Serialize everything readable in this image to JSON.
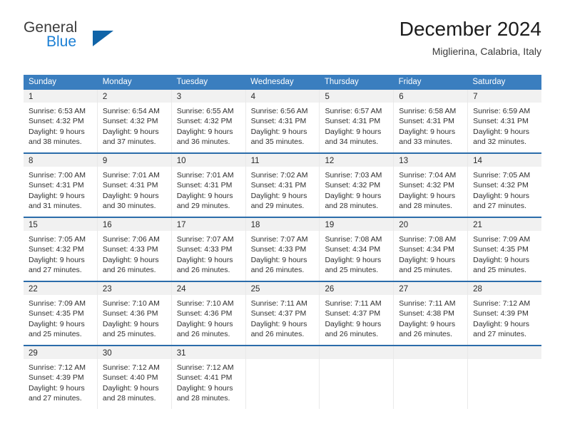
{
  "brand": {
    "name_part1": "General",
    "name_part2": "Blue",
    "logo_icon": "triangle-logo-icon"
  },
  "header": {
    "title": "December 2024",
    "subtitle": "Miglierina, Calabria, Italy"
  },
  "colors": {
    "header_blue": "#3a7ebf",
    "row_separator_blue": "#2b6caa",
    "daynum_band": "#f1f1f1",
    "brand_blue": "#1b7fd4",
    "logo_blue": "#1064a8"
  },
  "calendar": {
    "weekday_headers": [
      "Sunday",
      "Monday",
      "Tuesday",
      "Wednesday",
      "Thursday",
      "Friday",
      "Saturday"
    ],
    "weeks": [
      [
        {
          "day": "1",
          "sunrise": "Sunrise: 6:53 AM",
          "sunset": "Sunset: 4:32 PM",
          "daylight_line1": "Daylight: 9 hours",
          "daylight_line2": "and 38 minutes."
        },
        {
          "day": "2",
          "sunrise": "Sunrise: 6:54 AM",
          "sunset": "Sunset: 4:32 PM",
          "daylight_line1": "Daylight: 9 hours",
          "daylight_line2": "and 37 minutes."
        },
        {
          "day": "3",
          "sunrise": "Sunrise: 6:55 AM",
          "sunset": "Sunset: 4:32 PM",
          "daylight_line1": "Daylight: 9 hours",
          "daylight_line2": "and 36 minutes."
        },
        {
          "day": "4",
          "sunrise": "Sunrise: 6:56 AM",
          "sunset": "Sunset: 4:31 PM",
          "daylight_line1": "Daylight: 9 hours",
          "daylight_line2": "and 35 minutes."
        },
        {
          "day": "5",
          "sunrise": "Sunrise: 6:57 AM",
          "sunset": "Sunset: 4:31 PM",
          "daylight_line1": "Daylight: 9 hours",
          "daylight_line2": "and 34 minutes."
        },
        {
          "day": "6",
          "sunrise": "Sunrise: 6:58 AM",
          "sunset": "Sunset: 4:31 PM",
          "daylight_line1": "Daylight: 9 hours",
          "daylight_line2": "and 33 minutes."
        },
        {
          "day": "7",
          "sunrise": "Sunrise: 6:59 AM",
          "sunset": "Sunset: 4:31 PM",
          "daylight_line1": "Daylight: 9 hours",
          "daylight_line2": "and 32 minutes."
        }
      ],
      [
        {
          "day": "8",
          "sunrise": "Sunrise: 7:00 AM",
          "sunset": "Sunset: 4:31 PM",
          "daylight_line1": "Daylight: 9 hours",
          "daylight_line2": "and 31 minutes."
        },
        {
          "day": "9",
          "sunrise": "Sunrise: 7:01 AM",
          "sunset": "Sunset: 4:31 PM",
          "daylight_line1": "Daylight: 9 hours",
          "daylight_line2": "and 30 minutes."
        },
        {
          "day": "10",
          "sunrise": "Sunrise: 7:01 AM",
          "sunset": "Sunset: 4:31 PM",
          "daylight_line1": "Daylight: 9 hours",
          "daylight_line2": "and 29 minutes."
        },
        {
          "day": "11",
          "sunrise": "Sunrise: 7:02 AM",
          "sunset": "Sunset: 4:31 PM",
          "daylight_line1": "Daylight: 9 hours",
          "daylight_line2": "and 29 minutes."
        },
        {
          "day": "12",
          "sunrise": "Sunrise: 7:03 AM",
          "sunset": "Sunset: 4:32 PM",
          "daylight_line1": "Daylight: 9 hours",
          "daylight_line2": "and 28 minutes."
        },
        {
          "day": "13",
          "sunrise": "Sunrise: 7:04 AM",
          "sunset": "Sunset: 4:32 PM",
          "daylight_line1": "Daylight: 9 hours",
          "daylight_line2": "and 28 minutes."
        },
        {
          "day": "14",
          "sunrise": "Sunrise: 7:05 AM",
          "sunset": "Sunset: 4:32 PM",
          "daylight_line1": "Daylight: 9 hours",
          "daylight_line2": "and 27 minutes."
        }
      ],
      [
        {
          "day": "15",
          "sunrise": "Sunrise: 7:05 AM",
          "sunset": "Sunset: 4:32 PM",
          "daylight_line1": "Daylight: 9 hours",
          "daylight_line2": "and 27 minutes."
        },
        {
          "day": "16",
          "sunrise": "Sunrise: 7:06 AM",
          "sunset": "Sunset: 4:33 PM",
          "daylight_line1": "Daylight: 9 hours",
          "daylight_line2": "and 26 minutes."
        },
        {
          "day": "17",
          "sunrise": "Sunrise: 7:07 AM",
          "sunset": "Sunset: 4:33 PM",
          "daylight_line1": "Daylight: 9 hours",
          "daylight_line2": "and 26 minutes."
        },
        {
          "day": "18",
          "sunrise": "Sunrise: 7:07 AM",
          "sunset": "Sunset: 4:33 PM",
          "daylight_line1": "Daylight: 9 hours",
          "daylight_line2": "and 26 minutes."
        },
        {
          "day": "19",
          "sunrise": "Sunrise: 7:08 AM",
          "sunset": "Sunset: 4:34 PM",
          "daylight_line1": "Daylight: 9 hours",
          "daylight_line2": "and 25 minutes."
        },
        {
          "day": "20",
          "sunrise": "Sunrise: 7:08 AM",
          "sunset": "Sunset: 4:34 PM",
          "daylight_line1": "Daylight: 9 hours",
          "daylight_line2": "and 25 minutes."
        },
        {
          "day": "21",
          "sunrise": "Sunrise: 7:09 AM",
          "sunset": "Sunset: 4:35 PM",
          "daylight_line1": "Daylight: 9 hours",
          "daylight_line2": "and 25 minutes."
        }
      ],
      [
        {
          "day": "22",
          "sunrise": "Sunrise: 7:09 AM",
          "sunset": "Sunset: 4:35 PM",
          "daylight_line1": "Daylight: 9 hours",
          "daylight_line2": "and 25 minutes."
        },
        {
          "day": "23",
          "sunrise": "Sunrise: 7:10 AM",
          "sunset": "Sunset: 4:36 PM",
          "daylight_line1": "Daylight: 9 hours",
          "daylight_line2": "and 25 minutes."
        },
        {
          "day": "24",
          "sunrise": "Sunrise: 7:10 AM",
          "sunset": "Sunset: 4:36 PM",
          "daylight_line1": "Daylight: 9 hours",
          "daylight_line2": "and 26 minutes."
        },
        {
          "day": "25",
          "sunrise": "Sunrise: 7:11 AM",
          "sunset": "Sunset: 4:37 PM",
          "daylight_line1": "Daylight: 9 hours",
          "daylight_line2": "and 26 minutes."
        },
        {
          "day": "26",
          "sunrise": "Sunrise: 7:11 AM",
          "sunset": "Sunset: 4:37 PM",
          "daylight_line1": "Daylight: 9 hours",
          "daylight_line2": "and 26 minutes."
        },
        {
          "day": "27",
          "sunrise": "Sunrise: 7:11 AM",
          "sunset": "Sunset: 4:38 PM",
          "daylight_line1": "Daylight: 9 hours",
          "daylight_line2": "and 26 minutes."
        },
        {
          "day": "28",
          "sunrise": "Sunrise: 7:12 AM",
          "sunset": "Sunset: 4:39 PM",
          "daylight_line1": "Daylight: 9 hours",
          "daylight_line2": "and 27 minutes."
        }
      ],
      [
        {
          "day": "29",
          "sunrise": "Sunrise: 7:12 AM",
          "sunset": "Sunset: 4:39 PM",
          "daylight_line1": "Daylight: 9 hours",
          "daylight_line2": "and 27 minutes."
        },
        {
          "day": "30",
          "sunrise": "Sunrise: 7:12 AM",
          "sunset": "Sunset: 4:40 PM",
          "daylight_line1": "Daylight: 9 hours",
          "daylight_line2": "and 28 minutes."
        },
        {
          "day": "31",
          "sunrise": "Sunrise: 7:12 AM",
          "sunset": "Sunset: 4:41 PM",
          "daylight_line1": "Daylight: 9 hours",
          "daylight_line2": "and 28 minutes."
        },
        {
          "day": "",
          "sunrise": "",
          "sunset": "",
          "daylight_line1": "",
          "daylight_line2": ""
        },
        {
          "day": "",
          "sunrise": "",
          "sunset": "",
          "daylight_line1": "",
          "daylight_line2": ""
        },
        {
          "day": "",
          "sunrise": "",
          "sunset": "",
          "daylight_line1": "",
          "daylight_line2": ""
        },
        {
          "day": "",
          "sunrise": "",
          "sunset": "",
          "daylight_line1": "",
          "daylight_line2": ""
        }
      ]
    ]
  }
}
